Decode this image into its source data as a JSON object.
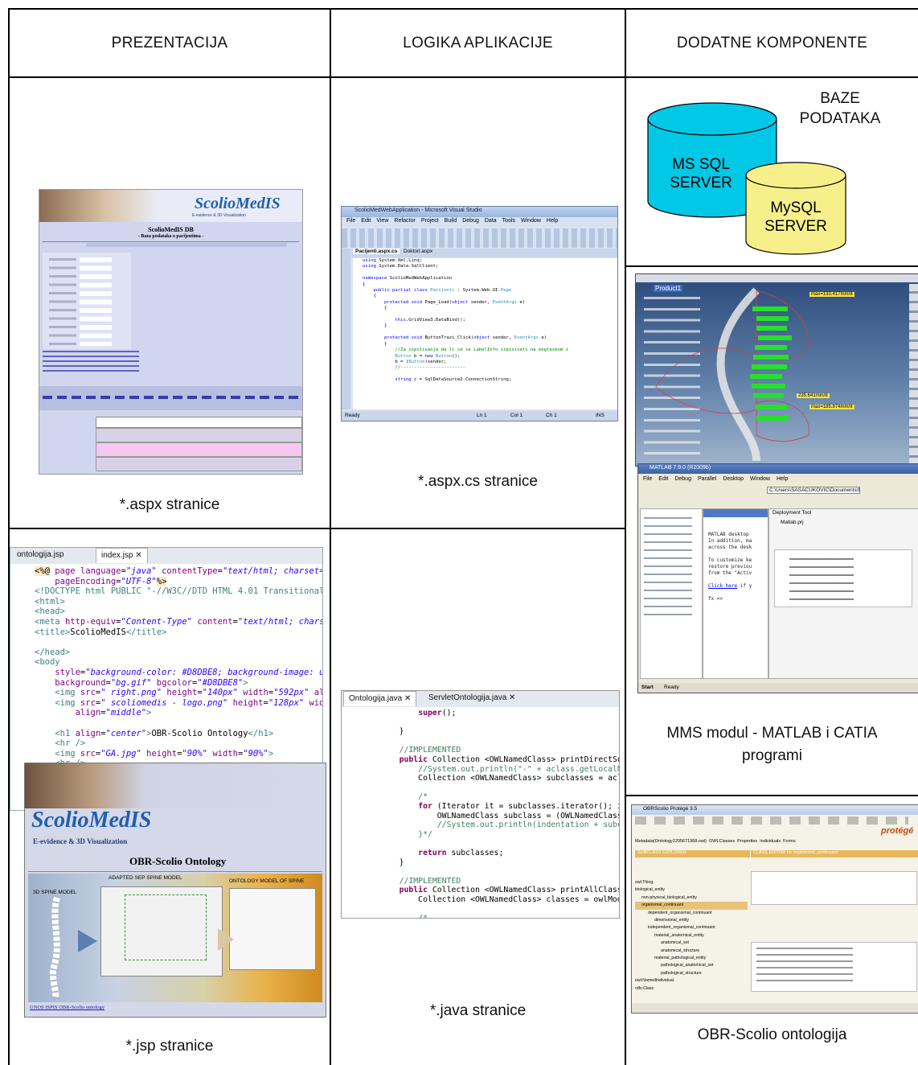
{
  "columns": {
    "prezentacija": "PREZENTACIJA",
    "logika": "LOGIKA APLIKACIJE",
    "dodatne": "DODATNE KOMPONENTE"
  },
  "captions": {
    "aspx": "*.aspx stranice",
    "aspxcs": "*.aspx.cs stranice",
    "jsp": "*.jsp stranice",
    "java": "*.java stranice",
    "mms_line1": "MMS modul - MATLAB i CATIA",
    "mms_line2": "programi",
    "obr": "OBR-Scolio ontologija"
  },
  "databases": {
    "title_line1": "BAZE",
    "title_line2": "PODATAKA",
    "mssql_line1": "MS SQL",
    "mssql_line2": "SERVER",
    "mysql_line1": "MySQL",
    "mysql_line2": "SERVER",
    "mssql_color": "#00c8e6",
    "mysql_color": "#f7f08a"
  },
  "aspx_shot": {
    "logo": "ScolioMedIS",
    "logo_sub": "E-evidence & 3D Visualization",
    "title": "ScolioMedIS DB",
    "subtitle": "- Baza podataka o pacijentima -"
  },
  "vs_shot": {
    "window_title": "ScolioMedWebApplication - Microsoft Visual Studio",
    "menu": [
      "File",
      "Edit",
      "View",
      "Refactor",
      "Project",
      "Build",
      "Debug",
      "Data",
      "Tools",
      "Window",
      "Help"
    ],
    "tab1": "Pacijenti.aspx.cs",
    "tab2": "Doktori.aspx",
    "status": "Ready",
    "status_ln": "Ln 1",
    "status_col": "Col 1",
    "status_ch": "Ch 1",
    "status_ins": "INS"
  },
  "jsp_shot": {
    "tab1": "ontologija.jsp",
    "tab2": "index.jsp"
  },
  "ontology_page": {
    "logo": "ScolioMedIS",
    "logo_sub": "E-evidence & 3D Visualization",
    "title": "OBR-Scolio Ontology",
    "diagram_left": "3D SPINE MODEL",
    "diagram_mid": "ADAPTED SEP SPINE MODEL",
    "diagram_right": "ONTOLOGY MODEL OF SPINE",
    "footer_links": "UNOS ISPIS OBR-Scolio ontology"
  },
  "java_shot": {
    "tab1": "Ontologija.java",
    "tab2": "ServletOntologija.java"
  },
  "catia_shot": {
    "root": "Product1",
    "label_top": "max=133.417mm/8",
    "label_mid": "235.641mm/8",
    "label_low": "max=185.874mm/8"
  },
  "matlab_shot": {
    "window_title": "MATLAB 7.9.0 (R2009b)",
    "menu": [
      "File",
      "Edit",
      "Debug",
      "Parallel",
      "Desktop",
      "Window",
      "Help"
    ],
    "path": "C:\\Users\\SASACUKOVIC\\Documents\\MATLAB",
    "deploy_title": "Deployment Tool",
    "project": "Matlab.prj",
    "start": "Start",
    "ready": "Ready"
  },
  "protege_shot": {
    "window_title": "OBRScolio  Protégé 3.5",
    "brand": "protégé",
    "tabs": [
      "Metadata(Ontology1295671968.owl)",
      "OWLClasses",
      "Properties",
      "Individuals",
      "Forms"
    ],
    "left_header": "SUBCLASS EXPLORER",
    "right_header": "CLASS EDITOR for organismal_continuant",
    "tree": [
      "owl:Thing",
      "biological_entity",
      "non-physical_biological_entity",
      "organismal_continuant",
      "dependent_organismal_continuant",
      "dimensional_entity",
      "independent_organismal_continuant",
      "material_anatomical_entity",
      "anatomical_set",
      "anatomical_structure",
      "material_pathological_entity",
      "pathological_anatomical_set",
      "pathological_structure",
      "owl:NamedIndividual",
      "rdfs:Class"
    ]
  }
}
